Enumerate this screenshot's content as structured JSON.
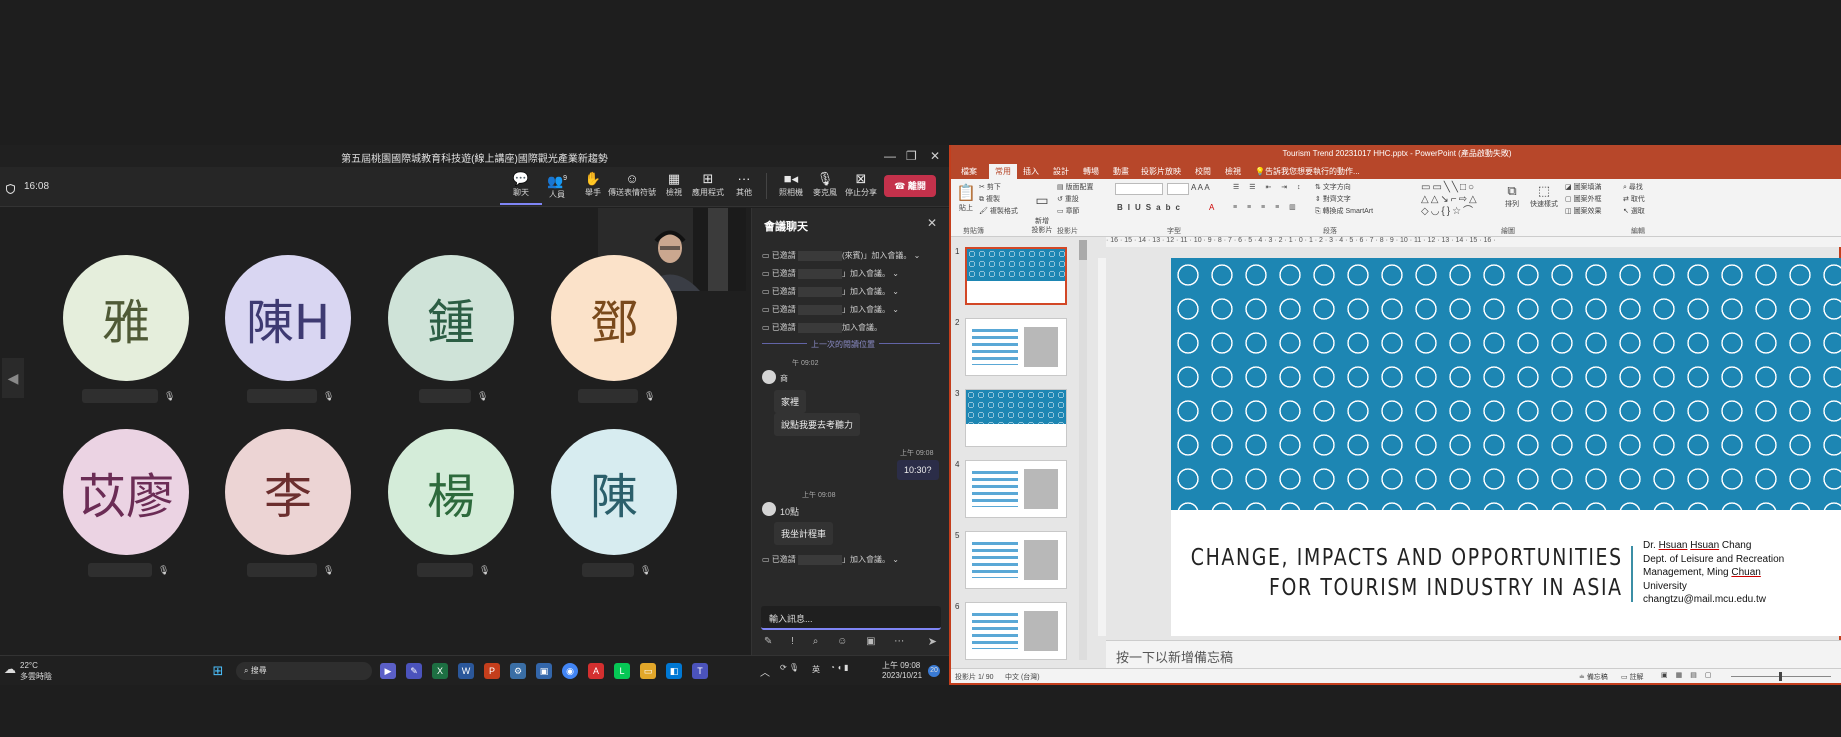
{
  "teams": {
    "window_title": "第五屆桃園國際城教育科技遊(線上講座)國際觀光產業新趨勢",
    "timer": "16:08",
    "toolbar": [
      {
        "label": "聊天",
        "icon": "chat-icon"
      },
      {
        "label": "人員",
        "icon": "people-icon",
        "badge": "9"
      },
      {
        "label": "舉手",
        "icon": "raise-hand-icon"
      },
      {
        "label": "傳送表情符號",
        "icon": "emoji-icon"
      },
      {
        "label": "檢視",
        "icon": "view-icon"
      },
      {
        "label": "應用程式",
        "icon": "apps-icon"
      },
      {
        "label": "其他",
        "icon": "more-icon"
      },
      {
        "label": "照相機",
        "icon": "camera-icon"
      },
      {
        "label": "麥克風",
        "icon": "mic-icon"
      },
      {
        "label": "停止分享",
        "icon": "stop-share-icon"
      }
    ],
    "leave_label": "離開",
    "participants": [
      {
        "initials": "雅",
        "bg": "#e5eedc",
        "fg": "#4f5a36"
      },
      {
        "initials": "陳H",
        "bg": "#d9d6f2",
        "fg": "#3e3a72"
      },
      {
        "initials": "鍾",
        "bg": "#cfe3d8",
        "fg": "#2c5e44"
      },
      {
        "initials": "鄧",
        "bg": "#fbe2c9",
        "fg": "#7a4a1c"
      },
      {
        "initials": "苡廖",
        "bg": "#ebd3e3",
        "fg": "#6b2c55"
      },
      {
        "initials": "李",
        "bg": "#ecd4d4",
        "fg": "#6b2e2e"
      },
      {
        "initials": "楊",
        "bg": "#d4ecd9",
        "fg": "#2d6a3c"
      },
      {
        "initials": "陳",
        "bg": "#d7ecf0",
        "fg": "#2b5f6b"
      }
    ],
    "chat": {
      "title": "會議聊天",
      "system_lines": [
        "已邀請",
        "已邀請",
        "已邀請",
        "已邀請",
        "已邀請"
      ],
      "system_suffixes": [
        "(來賓)」加入會議。",
        "」加入會議。",
        "」加入會議。",
        "」加入會議。",
        "加入會議。"
      ],
      "last_read": "上一次的閱讀位置",
      "time1": "午 09:02",
      "sender1": "商",
      "msg1": "家裡",
      "msg2": "說點我要去考聽力",
      "time2": "上午 09:08",
      "my_msg": "10:30?",
      "time3": "上午 09:08",
      "msg3": "10點",
      "msg4": "我坐計程車",
      "sys_last_prefix": "已邀請",
      "sys_last_suffix": "」加入會議。",
      "placeholder": "輸入訊息..."
    }
  },
  "taskbar": {
    "weather_temp": "22°C",
    "weather_desc": "多雲時陰",
    "search": "搜尋",
    "lang": "英",
    "time": "上午 09:08",
    "date": "2023/10/21",
    "notif": "20"
  },
  "ppt": {
    "title": "Tourism Trend 20231017 HHC.pptx - PowerPoint (產品啟動失敗)",
    "tabs": [
      "檔案",
      "常用",
      "插入",
      "設計",
      "轉場",
      "動畫",
      "投影片放映",
      "校閱",
      "檢視"
    ],
    "tell_me": "告訴我您想要執行的動作...",
    "ribbon_groups": [
      "剪貼簿",
      "投影片",
      "字型",
      "段落",
      "繪圖",
      "編輯"
    ],
    "ribbon_items": {
      "paste": "貼上",
      "new_slide": "新增\n投影片",
      "layout": "版面配置",
      "reset": "重設",
      "section": "章節",
      "cut": "剪下",
      "copy": "複製",
      "format_painter": "複製格式",
      "text_direction": "文字方向",
      "align_text": "對齊文字",
      "smartart": "轉換成 SmartArt",
      "arrange": "排列",
      "quick_styles": "快速樣式",
      "shape_fill": "圖案填滿",
      "shape_outline": "圖案外框",
      "shape_effects": "圖案效果",
      "find": "尋找",
      "replace": "取代",
      "select": "選取"
    },
    "ruler": "· 16 · 15 · 14 · 13 · 12 · 11 · 10 · 9 · 8 · 7 · 6 · 5 · 4 · 3 · 2 · 1 · 0 · 1 · 2 · 3 · 4 · 5 · 6 · 7 · 8 · 9 · 10 · 11 · 12 · 13 · 14 · 15 · 16 ·",
    "slide_numbers": [
      "1",
      "2",
      "3",
      "4",
      "5",
      "6"
    ],
    "slide": {
      "title_line1": "CHANGE, IMPACTS AND OPPORTUNITIES",
      "title_line2": "FOR TOURISM INDUSTRY IN ASIA",
      "author_prefix": "Dr. ",
      "author_name1": "Hsuan",
      "author_name2": "Hsuan",
      "author_suffix": " Chang",
      "dept1": "Dept. of Leisure and Recreation",
      "dept2a": "Management, Ming ",
      "dept2b": "Chuan",
      "dept3": "University",
      "email": "changtzu@mail.mcu.edu.tw"
    },
    "notes_placeholder": "按一下以新增備忘稿",
    "status_slide": "投影片 1/ 90",
    "status_lang": "中文 (台灣)",
    "status_notes": "備忘稿",
    "status_comments": "註解"
  }
}
